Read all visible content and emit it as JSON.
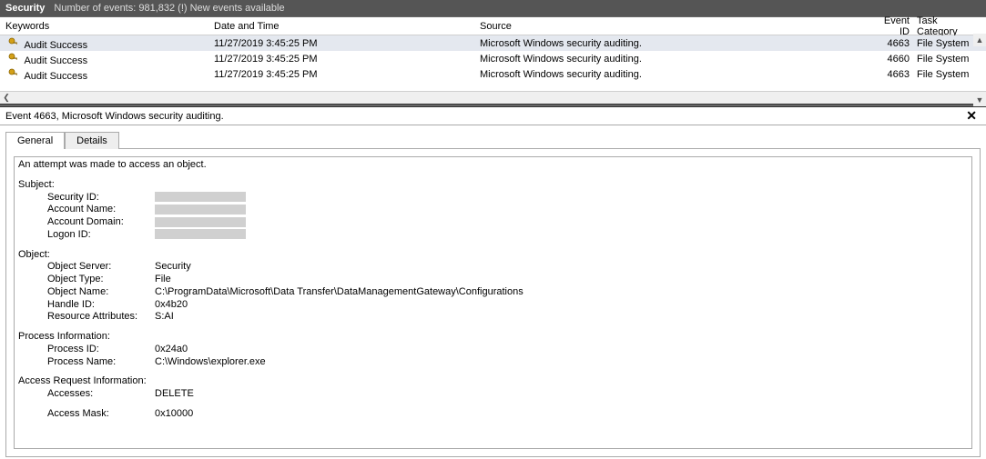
{
  "titlebar": {
    "app": "Security",
    "count_label": "Number of events: 981,832 (!) New events available"
  },
  "columns": {
    "keywords": "Keywords",
    "datetime": "Date and Time",
    "source": "Source",
    "eventid": "Event ID",
    "taskcat": "Task Category"
  },
  "rows": [
    {
      "keywords": "Audit Success",
      "datetime": "11/27/2019 3:45:25 PM",
      "source": "Microsoft Windows security auditing.",
      "eventid": "4663",
      "taskcat": "File System"
    },
    {
      "keywords": "Audit Success",
      "datetime": "11/27/2019 3:45:25 PM",
      "source": "Microsoft Windows security auditing.",
      "eventid": "4660",
      "taskcat": "File System"
    },
    {
      "keywords": "Audit Success",
      "datetime": "11/27/2019 3:45:25 PM",
      "source": "Microsoft Windows security auditing.",
      "eventid": "4663",
      "taskcat": "File System"
    }
  ],
  "detail": {
    "title": "Event 4663, Microsoft Windows security auditing.",
    "tabs": {
      "general": "General",
      "details": "Details"
    },
    "summary_line": "An attempt was made to access an object.",
    "subject": {
      "heading": "Subject:",
      "security_id_k": "Security ID:",
      "account_name_k": "Account Name:",
      "account_domain_k": "Account Domain:",
      "logon_id_k": "Logon ID:"
    },
    "object": {
      "heading": "Object:",
      "server_k": "Object Server:",
      "server_v": "Security",
      "type_k": "Object Type:",
      "type_v": "File",
      "name_k": "Object Name:",
      "name_v": "C:\\ProgramData\\Microsoft\\Data Transfer\\DataManagementGateway\\Configurations",
      "handle_k": "Handle ID:",
      "handle_v": "0x4b20",
      "resattr_k": "Resource Attributes:",
      "resattr_v": "S:AI"
    },
    "process": {
      "heading": "Process Information:",
      "pid_k": "Process ID:",
      "pid_v": "0x24a0",
      "pname_k": "Process Name:",
      "pname_v": "C:\\Windows\\explorer.exe"
    },
    "access": {
      "heading": "Access Request Information:",
      "accesses_k": "Accesses:",
      "accesses_v": "DELETE",
      "mask_k": "Access Mask:",
      "mask_v": "0x10000"
    }
  }
}
